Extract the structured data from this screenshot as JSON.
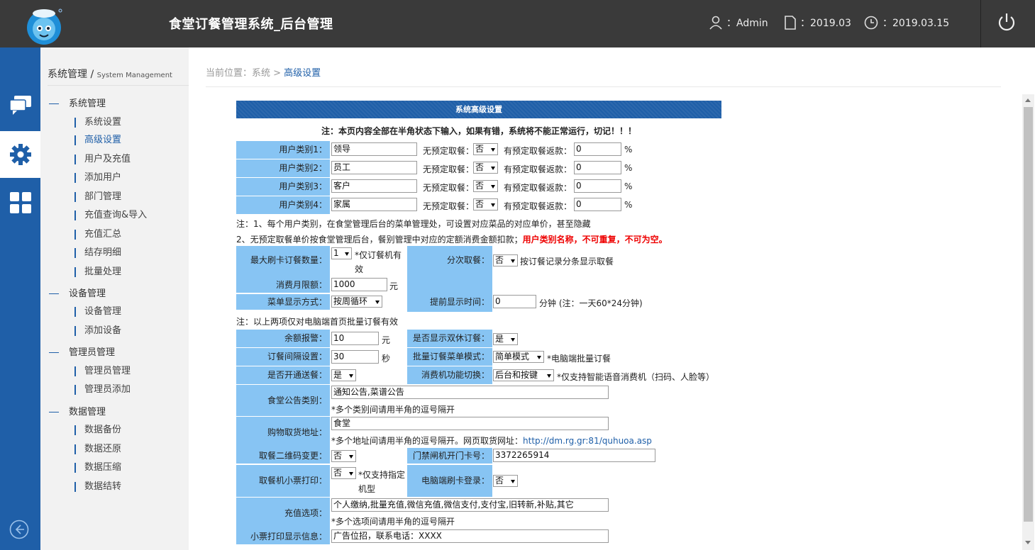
{
  "header": {
    "title": "食堂订餐管理系统_后台管理",
    "user": "：Admin",
    "version": "：2019.03",
    "date": "：2019.03.15"
  },
  "nav": {
    "title": "系统管理 / ",
    "title_en": "System Management",
    "groups": [
      {
        "label": "系统管理",
        "items": [
          "系统设置",
          "高级设置",
          "用户及充值",
          "添加用户",
          "部门管理",
          "充值查询&导入",
          "充值汇总",
          "结存明细",
          "批量处理"
        ]
      },
      {
        "label": "设备管理",
        "items": [
          "设备管理",
          "添加设备"
        ]
      },
      {
        "label": "管理员管理",
        "items": [
          "管理员管理",
          "管理员添加"
        ]
      },
      {
        "label": "数据管理",
        "items": [
          "数据备份",
          "数据还原",
          "数据压缩",
          "数据结转"
        ]
      }
    ]
  },
  "breadcrumb": {
    "prefix": "当前位置：系统 > ",
    "current": "高级设置"
  },
  "form": {
    "header": "系统高级设置",
    "warning": "注：本页内容全部在半角状态下输入，如果有错，系统将不能正常运行，切记！！！",
    "user_types": [
      {
        "label": "用户类别1：",
        "value": "领导",
        "no_order_label": "无预定取餐：",
        "no_order": "否",
        "refund_label": "有预定取餐返款：",
        "refund": "0",
        "unit": "%"
      },
      {
        "label": "用户类别2：",
        "value": "员工",
        "no_order_label": "无预定取餐：",
        "no_order": "否",
        "refund_label": "有预定取餐返款：",
        "refund": "0",
        "unit": "%"
      },
      {
        "label": "用户类别3：",
        "value": "客户",
        "no_order_label": "无预定取餐：",
        "no_order": "否",
        "refund_label": "有预定取餐返款：",
        "refund": "0",
        "unit": "%"
      },
      {
        "label": "用户类别4：",
        "value": "家属",
        "no_order_label": "无预定取餐：",
        "no_order": "否",
        "refund_label": "有预定取餐返款：",
        "refund": "0",
        "unit": "%"
      }
    ],
    "note1": "注：1、每个用户类别，在食堂管理后台的菜单管理处，可设置对应菜品的对应单价，甚至隐藏",
    "note2": "2、无预定取餐单价按食堂管理后台，餐别管理中对应的定额消费金额扣款；",
    "note2_red": "用户类别名称，不可重复，不可为空。",
    "max_swipe_label": "最大刷卡订餐数量：",
    "max_swipe": "1",
    "max_swipe_note": "*仅订餐机有效",
    "split_label": "分次取餐：",
    "split": "否",
    "split_note": "按订餐记录分条显示取餐",
    "monthly_label": "消费月限额：",
    "monthly": "1000",
    "monthly_unit": "元",
    "menu_mode_label": "菜单显示方式：",
    "menu_mode": "按周循环",
    "advance_label": "提前显示时间：",
    "advance": "0",
    "advance_note": "分钟 (注：一天60*24分钟)",
    "note3": "注：以上两项仅对电脑端首页批量订餐有效",
    "balance_label": "余额报警：",
    "balance": "10",
    "balance_unit": "元",
    "weekend_label": "是否显示双休订餐：",
    "weekend": "是",
    "interval_label": "订餐间隔设置：",
    "interval": "30",
    "interval_unit": "秒",
    "batch_label": "批量订餐菜单模式：",
    "batch": "简单模式",
    "batch_note": "*电脑端批量订餐",
    "delivery_label": "是否开通送餐：",
    "delivery": "是",
    "mode_label": "消费机功能切换：",
    "mode": "后台和按键",
    "mode_note": "*仅支持智能语音消费机（扫码、人脸等）",
    "notice_label": "食堂公告类别：",
    "notice": "通知公告,菜谱公告",
    "notice_note": "*多个类别间请用半角的逗号隔开",
    "pickup_label": "购物取货地址：",
    "pickup": "食堂",
    "pickup_note": "*多个地址间请用半角的逗号隔开。网页取货网址：",
    "pickup_url": "http://dm.rg.gr:81/quhuoa.asp",
    "qr_label": "取餐二维码变更：",
    "qr": "否",
    "door_label": "门禁闸机开门卡号：",
    "door": "3372265914",
    "ticket_label": "取餐机小票打印：",
    "ticket": "否",
    "ticket_note": "*仅支持指定机型",
    "pc_label": "电脑端刷卡登录：",
    "pc": "否",
    "recharge_label": "充值选项：",
    "recharge": "个人缴纳,批量充值,微信充值,微信支付,支付宝,旧转新,补贴,其它",
    "recharge_note": "*多个选项间请用半角的逗号隔开",
    "receipt_label": "小票打印显示信息：",
    "receipt": "广告位招，联系电话：XXXX"
  }
}
